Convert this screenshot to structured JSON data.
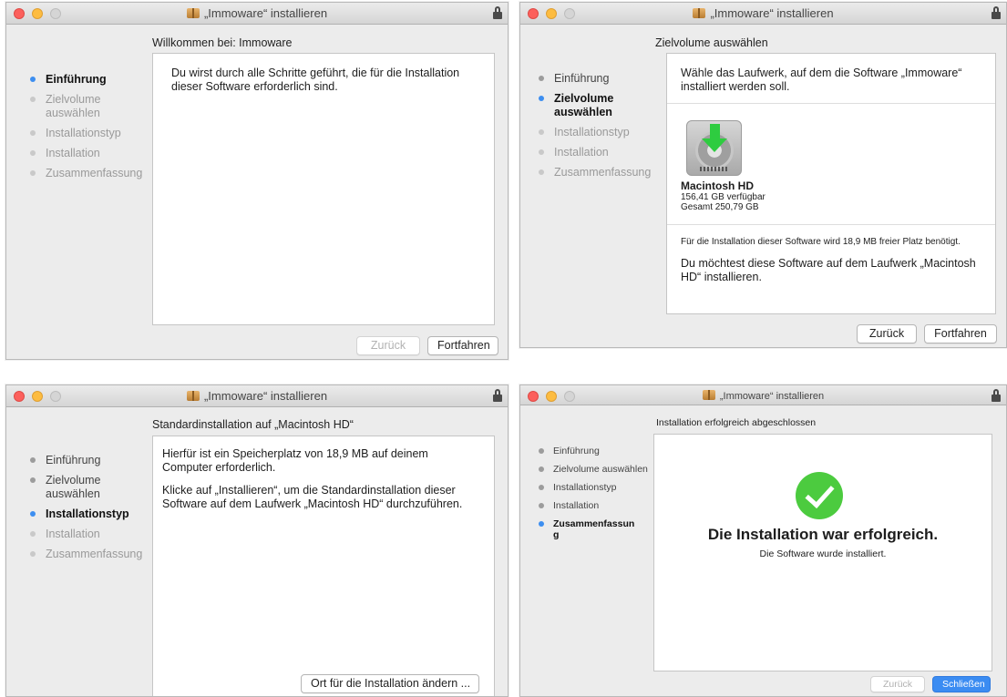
{
  "window_title": "„Immoware“ installieren",
  "steps": {
    "intro": "Einführung",
    "destination": "Zielvolume auswählen",
    "type": "Installationstyp",
    "install": "Installation",
    "summary": "Zusammenfassung"
  },
  "step_states": {
    "w1": [
      "active",
      "pending",
      "pending",
      "pending",
      "pending"
    ],
    "w2": [
      "done",
      "active",
      "pending",
      "pending",
      "pending"
    ],
    "w3": [
      "done",
      "done",
      "active",
      "pending",
      "pending"
    ],
    "w4": [
      "done",
      "done",
      "done",
      "done",
      "active"
    ]
  },
  "buttons": {
    "back": "Zurück",
    "continue": "Fortfahren",
    "change_location": "Ort für die Installation ändern ...",
    "close": "Schließen"
  },
  "screen1": {
    "heading": "Willkommen bei: Immoware",
    "body": "Du wirst durch alle Schritte geführt, die für die Installation dieser Software erforderlich sind."
  },
  "screen2": {
    "heading": "Zielvolume auswählen",
    "prompt": "Wähle das Laufwerk, auf dem die Software „Immoware“ installiert werden soll.",
    "volume_name": "Macintosh HD",
    "volume_available": "156,41 GB verfügbar",
    "volume_total": "Gesamt 250,79 GB",
    "space_note": "Für die Installation dieser Software wird 18,9 MB freier Platz benötigt.",
    "confirm": "Du möchtest diese Software auf dem Laufwerk „Macintosh HD“ installieren."
  },
  "screen3": {
    "heading": "Standardinstallation auf „Macintosh HD“",
    "para1": "Hierfür ist ein Speicherplatz von 18,9 MB auf deinem Computer erforderlich.",
    "para2": "Klicke auf „Installieren“, um die Standardinstallation dieser Software auf dem Laufwerk „Macintosh HD“ durchzuführen."
  },
  "screen4": {
    "heading": "Installation erfolgreich abgeschlossen",
    "success_title": "Die Installation war erfolgreich.",
    "success_sub": "Die Software wurde installiert."
  },
  "colors": {
    "accent": "#3d8ef0",
    "success": "#4ccb3f",
    "traffic_red": "#fc605c",
    "traffic_yellow": "#fdbc40"
  },
  "icons": [
    "package-icon",
    "lock-icon",
    "hard-drive-icon",
    "download-arrow-icon",
    "checkmark-icon"
  ]
}
